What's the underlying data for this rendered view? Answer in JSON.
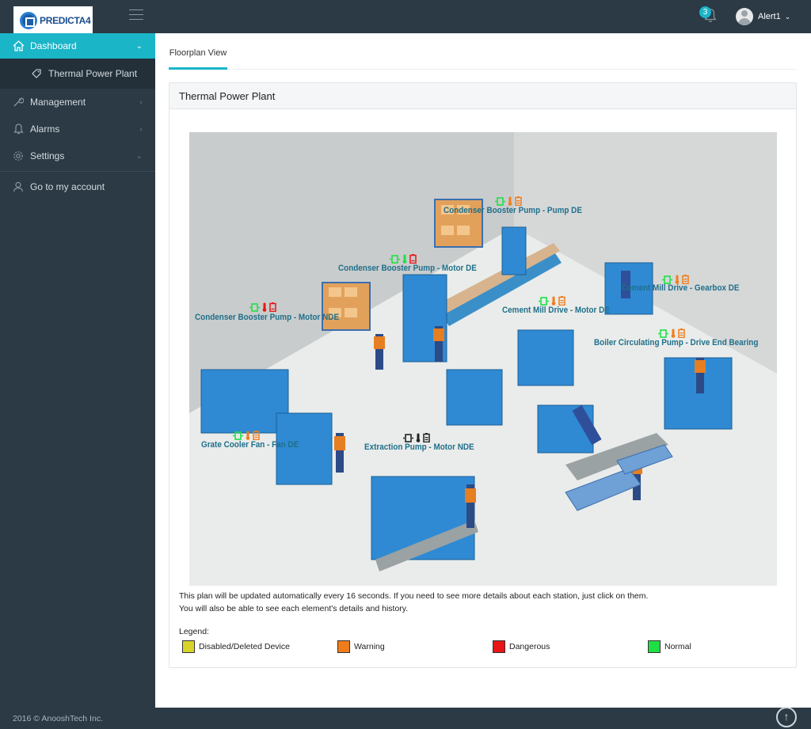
{
  "header": {
    "logo_text": "PREDICTA4",
    "notification_count": "3",
    "user_name": "Alert1"
  },
  "sidebar": {
    "items": [
      {
        "label": "Dashboard",
        "icon": "home-icon"
      },
      {
        "label": "Thermal Power Plant",
        "icon": "tag-icon"
      },
      {
        "label": "Management",
        "icon": "wrench-icon"
      },
      {
        "label": "Alarms",
        "icon": "bell-icon"
      },
      {
        "label": "Settings",
        "icon": "gear-icon"
      },
      {
        "label": "Go to my account",
        "icon": "user-icon"
      }
    ]
  },
  "main": {
    "tab_label": "Floorplan View",
    "panel_title": "Thermal Power Plant",
    "note_line1": "This plan will be updated automatically every 16 seconds. If you need to see more details about each station, just click on them.",
    "note_line2": "You will also be able to see each element's details and history.",
    "legend_title": "Legend:",
    "legend": [
      {
        "label": "Disabled/Deleted Device",
        "color": "#d8d42a"
      },
      {
        "label": "Warning",
        "color": "#f07d1c"
      },
      {
        "label": "Dangerous",
        "color": "#e81616"
      },
      {
        "label": "Normal",
        "color": "#1ee045"
      }
    ]
  },
  "stations": [
    {
      "label": "Condenser Booster Pump - Pump DE",
      "status": [
        "normal",
        "warning",
        "warning"
      ]
    },
    {
      "label": "Condenser Booster Pump - Motor DE",
      "status": [
        "normal",
        "normal",
        "dangerous"
      ]
    },
    {
      "label": "Condenser Booster Pump - Motor NDE",
      "status": [
        "normal",
        "dangerous",
        "dangerous"
      ]
    },
    {
      "label": "Cement Mill Drive - Gearbox DE",
      "status": [
        "normal",
        "warning",
        "warning"
      ]
    },
    {
      "label": "Cement Mill Drive - Motor DE",
      "status": [
        "normal",
        "warning",
        "warning"
      ]
    },
    {
      "label": "Boiler Circulating Pump - Drive End Bearing",
      "status": [
        "normal",
        "warning",
        "warning"
      ]
    },
    {
      "label": "Grate Cooler Fan - Fan DE",
      "status": [
        "normal",
        "warning",
        "warning"
      ]
    },
    {
      "label": "Extraction Pump - Motor NDE",
      "status": [
        "disabled",
        "disabled",
        "disabled"
      ]
    }
  ],
  "footer": {
    "copyright": "2016 © AnooshTech Inc."
  }
}
